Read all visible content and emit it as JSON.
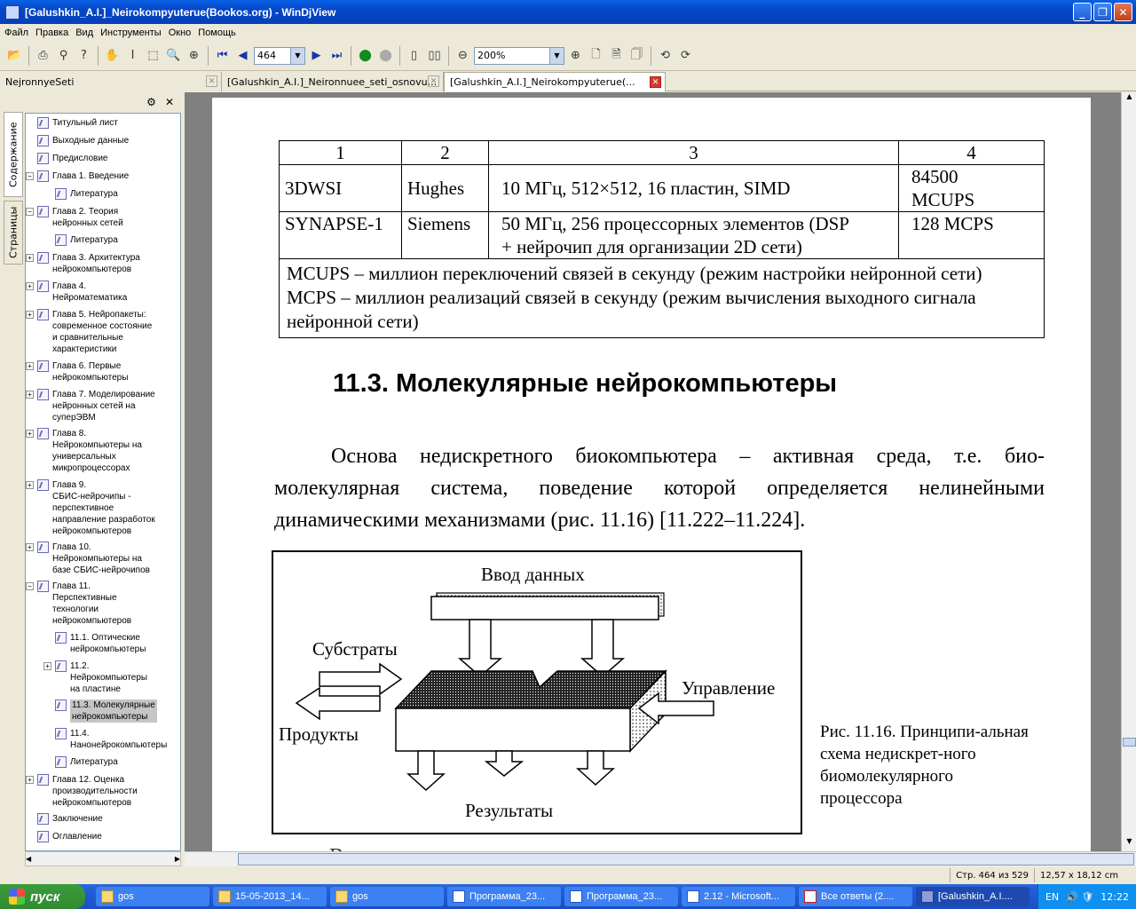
{
  "window": {
    "title": "[Galushkin_A.I.]_Neirokompyuterue(Bookos.org) - WinDjView"
  },
  "menu": [
    "Файл",
    "Правка",
    "Вид",
    "Инструменты",
    "Окно",
    "Помощь"
  ],
  "toolbar": {
    "page": "464",
    "zoom": "200%"
  },
  "tabs": [
    {
      "label": "NejronnyeSeti"
    },
    {
      "label": "[Galushkin_A.I.]_Neironnuee_seti_osnovu..."
    },
    {
      "label": "[Galushkin_A.I.]_Neirokompyuterue(..."
    }
  ],
  "sidetabs": {
    "contents": "Содержание",
    "pages": "Страницы"
  },
  "tree": [
    {
      "label": "Титульный лист",
      "lvl": 0
    },
    {
      "label": "Выходные данные",
      "lvl": 0
    },
    {
      "label": "Предисловие",
      "lvl": 0
    },
    {
      "label": "Глава 1. Введение",
      "lvl": 0,
      "exp": "−"
    },
    {
      "label": "Литература",
      "lvl": 1
    },
    {
      "label": "Глава 2. Теория\nнейронных сетей",
      "lvl": 0,
      "exp": "−"
    },
    {
      "label": "Литература",
      "lvl": 1
    },
    {
      "label": "Глава 3. Архитектура\nнейрокомпьютеров",
      "lvl": 0,
      "exp": "+"
    },
    {
      "label": "Глава 4.\nНейроматематика",
      "lvl": 0,
      "exp": "+"
    },
    {
      "label": "Глава 5. Нейропакеты:\nсовременное состояние\nи сравнительные\nхарактеристики",
      "lvl": 0,
      "exp": "+"
    },
    {
      "label": "Глава 6. Первые\nнейрокомпьютеры",
      "lvl": 0,
      "exp": "+"
    },
    {
      "label": "Глава 7. Моделирование\nнейронных сетей на\nсуперЭВМ",
      "lvl": 0,
      "exp": "+"
    },
    {
      "label": "Глава 8.\nНейрокомпьютеры на\nуниверсальных\nмикропроцессорах",
      "lvl": 0,
      "exp": "+"
    },
    {
      "label": "Глава 9.\nСБИС-нейрочипы -\nперспективное\nнаправление разработок\nнейрокомпьютеров",
      "lvl": 0,
      "exp": "+"
    },
    {
      "label": "Глава 10.\nНейрокомпьютеры на\nбазе СБИС-нейрочипов",
      "lvl": 0,
      "exp": "+"
    },
    {
      "label": "Глава 11.\nПерспективные\nтехнологии\nнейрокомпьютеров",
      "lvl": 0,
      "exp": "−"
    },
    {
      "label": "11.1. Оптические\nнейрокомпьютеры",
      "lvl": 1
    },
    {
      "label": "11.2.\nНейрокомпьютеры\nна пластине",
      "lvl": 1,
      "exp": "+"
    },
    {
      "label": "11.3. Молекулярные\nнейрокомпьютеры",
      "lvl": 1,
      "sel": true
    },
    {
      "label": "11.4.\nНанонейрокомпьютеры",
      "lvl": 1
    },
    {
      "label": "Литература",
      "lvl": 1
    },
    {
      "label": "Глава 12. Оценка\nпроизводительности\nнейрокомпьютеров",
      "lvl": 0,
      "exp": "+"
    },
    {
      "label": "Заключение",
      "lvl": 0
    },
    {
      "label": "Оглавление",
      "lvl": 0
    }
  ],
  "doc": {
    "table": {
      "header": [
        "1",
        "2",
        "3",
        "4"
      ],
      "rows": [
        [
          "3DWSI",
          "Hughes",
          "10 МГц, 512×512, 16 пластин, SIMD",
          "84500\nMCUPS"
        ],
        [
          "SYNAPSE-1",
          "Siemens",
          "50 МГц, 256 процессорных элементов (DSP\n+ нейрочип для организации 2D сети)",
          "128 MCPS"
        ]
      ],
      "note1": "MCUPS – миллион переключений связей в секунду (режим настройки нейронной сети)",
      "note2": "MCPS – миллион реализаций связей в секунду (режим вычисления выходного сигнала нейронной сети)"
    },
    "heading": "11.3. Молекулярные нейрокомпьютеры",
    "paragraph": "Основа недискретного биокомпьютера – активная среда, т.е. био-молекулярная система, поведение которой определяется нелинейными динамическими механизмами (рис. 11.16) [11.222–11.224].",
    "figure": {
      "input": "Ввод данных",
      "substrates": "Субстраты",
      "control": "Управление",
      "products": "Продукты",
      "results": "Результаты"
    },
    "caption": "Рис. 11.16. Принципи-альная схема недискрет-ного биомолекулярного процессора",
    "cutline": "В"
  },
  "status": {
    "page": "Стр. 464 из 529",
    "size": "12,57 x 18,12 cm"
  },
  "taskbar": {
    "start": "пуск",
    "items": [
      {
        "label": "gos",
        "icon": "folder"
      },
      {
        "label": "15-05-2013_14...",
        "icon": "folder"
      },
      {
        "label": "gos",
        "icon": "folder"
      },
      {
        "label": "Программа_23...",
        "icon": "word"
      },
      {
        "label": "Программа_23...",
        "icon": "word"
      },
      {
        "label": "2.12 - Microsoft...",
        "icon": "word"
      },
      {
        "label": "Все ответы (2....",
        "icon": "pdf"
      },
      {
        "label": "[Galushkin_A.I....",
        "icon": "dj"
      }
    ],
    "lang": "EN",
    "clock": "12:22"
  }
}
